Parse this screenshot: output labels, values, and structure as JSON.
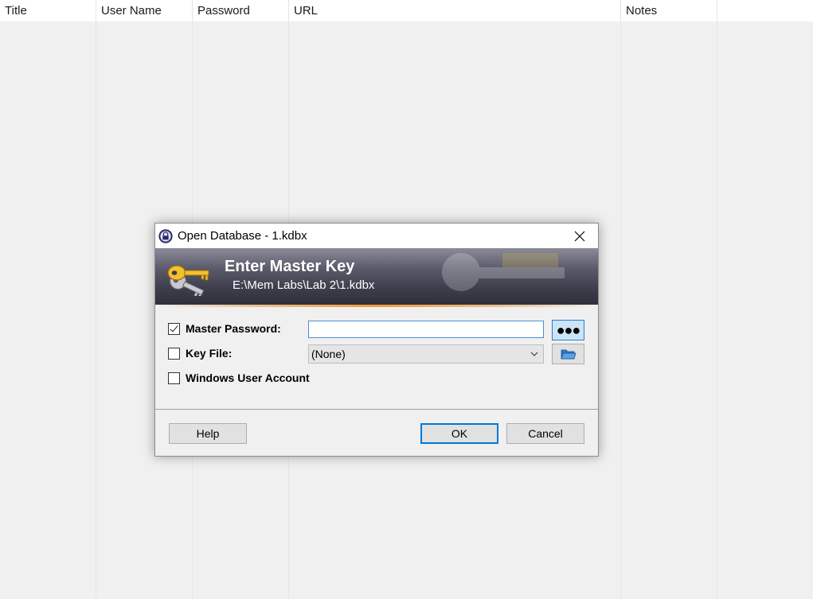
{
  "listview": {
    "columns": [
      {
        "label": "Title"
      },
      {
        "label": "User Name"
      },
      {
        "label": "Password"
      },
      {
        "label": "URL"
      },
      {
        "label": "Notes"
      }
    ]
  },
  "dialog": {
    "title": "Open Database - 1.kdbx",
    "banner": {
      "heading": "Enter Master Key",
      "path": "E:\\Mem Labs\\Lab 2\\1.kdbx"
    },
    "master_password": {
      "label": "Master Password:",
      "checked": true,
      "value": "",
      "reveal_label": "●●●"
    },
    "key_file": {
      "label": "Key File:",
      "checked": false,
      "selected": "(None)"
    },
    "windows_account": {
      "label": "Windows User Account",
      "checked": false
    },
    "buttons": {
      "help": "Help",
      "ok": "OK",
      "cancel": "Cancel"
    }
  },
  "colors": {
    "accent": "#0078d7",
    "banner_dark": "#2e2e3a",
    "banner_stripe": "#f29a3a",
    "dialog_bg": "#f0f0f0"
  },
  "icons": {
    "title": "lock-icon",
    "close": "close-icon",
    "banner": "keys-icon",
    "chevron": "chevron-down-icon",
    "folder": "folder-open-icon"
  }
}
